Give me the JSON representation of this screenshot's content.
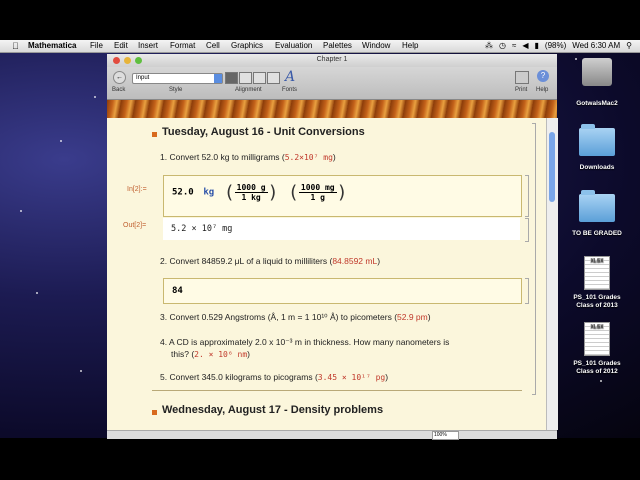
{
  "menubar": {
    "app": "Mathematica",
    "items": [
      "File",
      "Edit",
      "Insert",
      "Format",
      "Cell",
      "Graphics",
      "Evaluation",
      "Palettes",
      "Window",
      "Help"
    ],
    "battery": "(98%)",
    "clock": "Wed 6:30 AM"
  },
  "window": {
    "title": "Chapter 1",
    "toolbar": {
      "back_label": "Back",
      "style_label": "Style",
      "style_value": "Input",
      "alignment_label": "Alignment",
      "fonts_label": "Fonts",
      "print_label": "Print",
      "help_label": "Help"
    },
    "zoom": "100%"
  },
  "notebook": {
    "section1_title": "Tuesday, August 16 - Unit Conversions",
    "q1_text": "1. Convert 52.0 kg to milligrams (",
    "q1_answer": "5.2×10⁷ mg",
    "q1_close": ")",
    "in_label": "In[2]:=",
    "input_value": "52.0",
    "input_unit": "kg",
    "frac1_num": "1000 g",
    "frac1_den": "1 kg",
    "frac2_num": "1000 mg",
    "frac2_den": "1 g",
    "out_label": "Out[2]=",
    "output_value": "5.2 × 10⁷ mg",
    "q2_text": "2. Convert 84859.2 μL of a liquid to milliliters (",
    "q2_answer": "84.8592 mL",
    "q2_close": ")",
    "typing_value": "84",
    "q3_text": "3. Convert 0.529 Angstroms (Å, 1 m = 1 10¹⁰ Å) to picometers (",
    "q3_answer": "52.9 pm",
    "q3_close": ")",
    "q4_text_line1": "4. A CD is approximately 2.0 x 10⁻³ m in thickness.  How many nanometers is",
    "q4_text_line2": "this? (",
    "q4_answer": "2. × 10⁶ nm",
    "q4_close": ")",
    "q5_text": "5. Convert 345.0 kilograms to picograms (",
    "q5_answer": "3.45 × 10¹⁷ pg",
    "q5_close": ")",
    "section2_title": "Wednesday, August 17 - Density problems"
  },
  "desktop": {
    "icons": [
      {
        "label": "GotwalsMac2",
        "kind": "disk"
      },
      {
        "label": "Downloads",
        "kind": "folder"
      },
      {
        "label": "TO BE GRADED",
        "kind": "folder"
      },
      {
        "label": "PS_101 Grades Class of 2013",
        "kind": "xlsx"
      },
      {
        "label": "PS_101 Grades Class of 2012",
        "kind": "xlsx"
      }
    ],
    "xlsx_badge": "XLSX"
  }
}
